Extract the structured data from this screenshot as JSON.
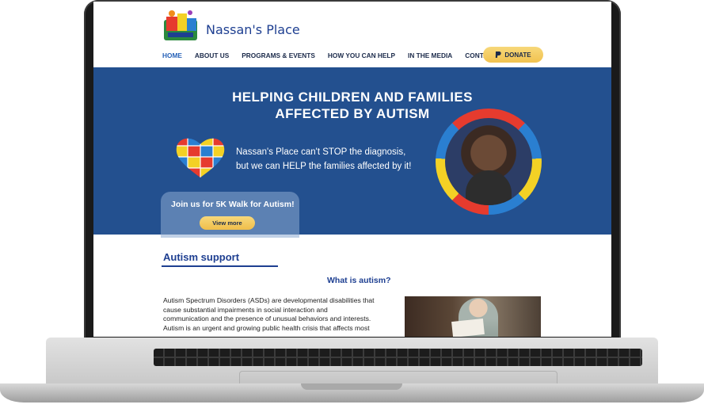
{
  "site": {
    "brand": "Nassan's Place",
    "logo_icon": "nassans-place-logo-icon"
  },
  "nav": {
    "items": [
      {
        "label": "HOME",
        "active": true
      },
      {
        "label": "ABOUT US"
      },
      {
        "label": "PROGRAMS & EVENTS"
      },
      {
        "label": "HOW YOU CAN HELP"
      },
      {
        "label": "IN THE MEDIA"
      },
      {
        "label": "CONTACT US"
      }
    ],
    "donate_label": "DONATE",
    "donate_icon": "paypal-icon"
  },
  "hero": {
    "title_line1": "HELPING CHILDREN AND FAMILIES",
    "title_line2": "AFFECTED BY AUTISM",
    "text_line1": "Nassan's Place can't STOP the diagnosis,",
    "text_line2": "but we can HELP the families affected by it!",
    "promo_title": "Join us for 5K Walk for Autism!",
    "promo_button": "View more",
    "heart_icon": "puzzle-heart-icon",
    "portrait_icon": "child-portrait"
  },
  "content": {
    "section_title": "Autism support",
    "subheading": "What is autism?",
    "body_lines": [
      "Autism Spectrum Disorders (ASDs) are developmental disabilities that",
      "cause substantial impairments in social interaction and",
      "communication and the presence of unusual behaviors and interests.",
      "Autism is an urgent and growing public health crisis that affects most"
    ]
  },
  "colors": {
    "hero_bg": "#23508f",
    "brand_blue": "#1e3f91",
    "button_gold": "#f1c24f",
    "nav_active": "#2762b8"
  }
}
